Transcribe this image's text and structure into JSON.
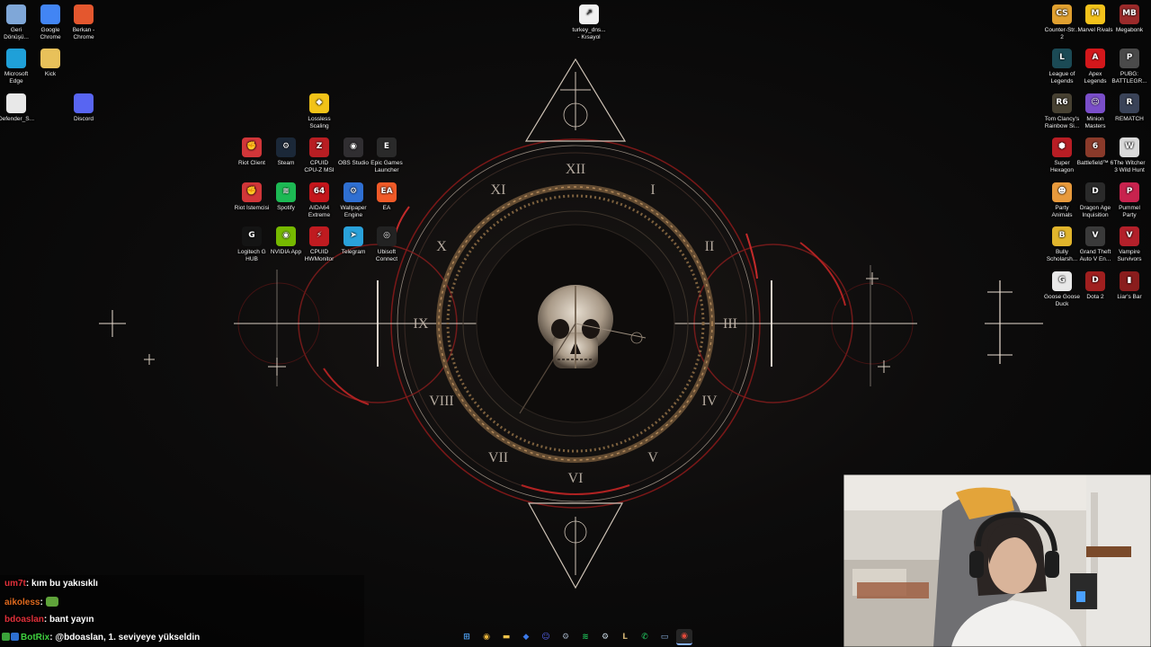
{
  "desktop": {
    "left_icons": [
      {
        "label": "Geri\nDönüşü...",
        "icon": "recycle-bin-icon",
        "color": "#7fa7d8"
      },
      {
        "label": "Google\nChrome",
        "icon": "chrome-icon",
        "color": "#4285f4"
      },
      {
        "label": "Berkan -\nChrome",
        "icon": "chrome-icon",
        "color": "#e4572e"
      },
      {
        "label": "Microsoft\nEdge",
        "icon": "edge-icon",
        "color": "#1fa0d8"
      },
      {
        "label": "Kick",
        "icon": "folder-icon",
        "color": "#e8c15a"
      },
      {
        "label": "Defender_S...",
        "icon": "file-icon",
        "color": "#e8e8e8"
      },
      {
        "label": "Discord",
        "icon": "discord-icon",
        "color": "#5865f2"
      }
    ],
    "shortcut_file": {
      "label": "turkey_dns...\n- Kısayol",
      "icon": "shortcut-file-icon"
    },
    "middle_icons": [
      {
        "label": "Lossless\nScaling",
        "icon": "duck-icon",
        "color": "#f2c318",
        "glyph": "◆"
      },
      {
        "label": "Riot Client",
        "icon": "riot-client-icon",
        "color": "#d13639",
        "glyph": "✊"
      },
      {
        "label": "Steam",
        "icon": "steam-icon",
        "color": "#1b2838",
        "glyph": "⚙"
      },
      {
        "label": "CPUID\nCPU-Z MSI",
        "icon": "cpuz-icon",
        "color": "#b81e23",
        "glyph": "Z"
      },
      {
        "label": "OBS Studio",
        "icon": "obs-icon",
        "color": "#302e31",
        "glyph": "◉"
      },
      {
        "label": "Epic Games\nLauncher",
        "icon": "epic-games-icon",
        "color": "#2a2a2a",
        "glyph": "E"
      },
      {
        "label": "Riot İstemcisi",
        "icon": "riot-client-icon",
        "color": "#d13639",
        "glyph": "✊"
      },
      {
        "label": "Spotify",
        "icon": "spotify-icon",
        "color": "#1db954",
        "glyph": "≋"
      },
      {
        "label": "AIDA64\nExtreme",
        "icon": "aida64-icon",
        "color": "#c4161c",
        "glyph": "64"
      },
      {
        "label": "Wallpaper\nEngine",
        "icon": "wallpaper-engine-icon",
        "color": "#2f6fd1",
        "glyph": "⚙"
      },
      {
        "label": "EA",
        "icon": "ea-icon",
        "color": "#f05a28",
        "glyph": "EA"
      },
      {
        "label": "Logitech G\nHUB",
        "icon": "logitech-icon",
        "color": "#141414",
        "glyph": "G"
      },
      {
        "label": "NVIDIA App",
        "icon": "nvidia-icon",
        "color": "#76b900",
        "glyph": "◉"
      },
      {
        "label": "CPUID\nHWMonitor",
        "icon": "hwmonitor-icon",
        "color": "#c01b20",
        "glyph": "⚡"
      },
      {
        "label": "Telegram",
        "icon": "telegram-icon",
        "color": "#2aa1da",
        "glyph": "➤"
      },
      {
        "label": "Ubisoft\nConnect",
        "icon": "ubisoft-icon",
        "color": "#222222",
        "glyph": "◎"
      }
    ],
    "right_icons": [
      {
        "label": "Counter-Str...\n2",
        "icon": "cs2-icon",
        "color": "#e0a030",
        "glyph": "CS"
      },
      {
        "label": "Marvel Rivals",
        "icon": "marvel-rivals-icon",
        "color": "#f3c21b",
        "glyph": "M"
      },
      {
        "label": "Megabonk",
        "icon": "megabonk-icon",
        "color": "#9b2a2a",
        "glyph": "MB"
      },
      {
        "label": "League of\nLegends",
        "icon": "league-icon",
        "color": "#1b4a55",
        "glyph": "L"
      },
      {
        "label": "Apex\nLegends",
        "icon": "apex-icon",
        "color": "#d3171b",
        "glyph": "A"
      },
      {
        "label": "PUBG:\nBATTLEGR...",
        "icon": "pubg-icon",
        "color": "#4a4a4a",
        "glyph": "P"
      },
      {
        "label": "Tom Clancy's\nRainbow Si...",
        "icon": "rainbow-six-icon",
        "color": "#474132",
        "glyph": "R6"
      },
      {
        "label": "Minion\nMasters",
        "icon": "minion-masters-icon",
        "color": "#7a4ec9",
        "glyph": "☺"
      },
      {
        "label": "REMATCH",
        "icon": "rematch-icon",
        "color": "#3a4358",
        "glyph": "R"
      },
      {
        "label": "Super\nHexagon",
        "icon": "super-hexagon-icon",
        "color": "#b81d24",
        "glyph": "⬢"
      },
      {
        "label": "Battlefield™ 6",
        "icon": "battlefield-icon",
        "color": "#8a3a2a",
        "glyph": "6"
      },
      {
        "label": "The Witcher\n3 Wild Hunt",
        "icon": "witcher-icon",
        "color": "#d9d9d9",
        "glyph": "W"
      },
      {
        "label": "Party\nAnimals",
        "icon": "party-animals-icon",
        "color": "#e89a3c",
        "glyph": "☻"
      },
      {
        "label": "Dragon Age\nInquisition",
        "icon": "dragon-age-icon",
        "color": "#2a2a2a",
        "glyph": "D"
      },
      {
        "label": "Pummel\nParty",
        "icon": "pummel-party-icon",
        "color": "#c8234e",
        "glyph": "P"
      },
      {
        "label": "Bully\nScholarsh...",
        "icon": "bully-icon",
        "color": "#e1b52c",
        "glyph": "B"
      },
      {
        "label": "Grand Theft\nAuto V En...",
        "icon": "gta-icon",
        "color": "#3a3a3a",
        "glyph": "V"
      },
      {
        "label": "Vampire\nSurvivors",
        "icon": "vampire-survivors-icon",
        "color": "#b3202a",
        "glyph": "V"
      },
      {
        "label": "Goose Goose\nDuck",
        "icon": "goose-goose-duck-icon",
        "color": "#e8e8e8",
        "glyph": "G"
      },
      {
        "label": "Dota 2",
        "icon": "dota2-icon",
        "color": "#a01f1f",
        "glyph": "D"
      },
      {
        "label": "Liar's Bar",
        "icon": "liars-bar-icon",
        "color": "#8a1d1d",
        "glyph": "▮"
      }
    ]
  },
  "wallpaper": {
    "numerals": [
      "XII",
      "I",
      "II",
      "III",
      "IV",
      "V",
      "VI",
      "VII",
      "VIII",
      "IX",
      "X",
      "XI"
    ],
    "accent_color": "#c42a2a",
    "gold_color": "#b48a5a"
  },
  "chat": {
    "messages": [
      {
        "user": "um7t",
        "sep": ": ",
        "text": "kım bu yakısıklı",
        "user_color": "#e0303a"
      },
      {
        "user": "aikoless",
        "sep": ": ",
        "text": "",
        "user_color": "#e06a1e",
        "emote": "frog-emote"
      },
      {
        "user": "bdoaslan",
        "sep": ": ",
        "text": "bant yayın",
        "user_color": "#e0303a"
      },
      {
        "user": "BotRix",
        "sep": ": ",
        "text": "@bdoaslan, 1. seviyeye yükseldin",
        "user_color": "#3fd13f",
        "badges": [
          "mod-badge",
          "bot-badge"
        ]
      }
    ]
  },
  "taskbar": {
    "icons": [
      {
        "name": "start-icon",
        "glyph": "⊞",
        "color": "#4fa3f7"
      },
      {
        "name": "chrome-icon",
        "glyph": "◉",
        "color": "#e8b33a"
      },
      {
        "name": "file-explorer-icon",
        "glyph": "▬",
        "color": "#f0c34a"
      },
      {
        "name": "app-blue-icon",
        "glyph": "◆",
        "color": "#3b78e7"
      },
      {
        "name": "discord-icon",
        "glyph": "☺",
        "color": "#5865f2"
      },
      {
        "name": "settings-icon",
        "glyph": "⚙",
        "color": "#9aa7b8"
      },
      {
        "name": "spotify-icon",
        "glyph": "≋",
        "color": "#1db954"
      },
      {
        "name": "steam-icon",
        "glyph": "⚙",
        "color": "#c7d5e0"
      },
      {
        "name": "league-icon",
        "glyph": "L",
        "color": "#c8aa6e"
      },
      {
        "name": "whatsapp-icon",
        "glyph": "✆",
        "color": "#25d366"
      },
      {
        "name": "network-icon",
        "glyph": "▭",
        "color": "#8fb7e8"
      },
      {
        "name": "obs-icon",
        "glyph": "◉",
        "color": "#e24a3b",
        "active": true
      }
    ]
  }
}
